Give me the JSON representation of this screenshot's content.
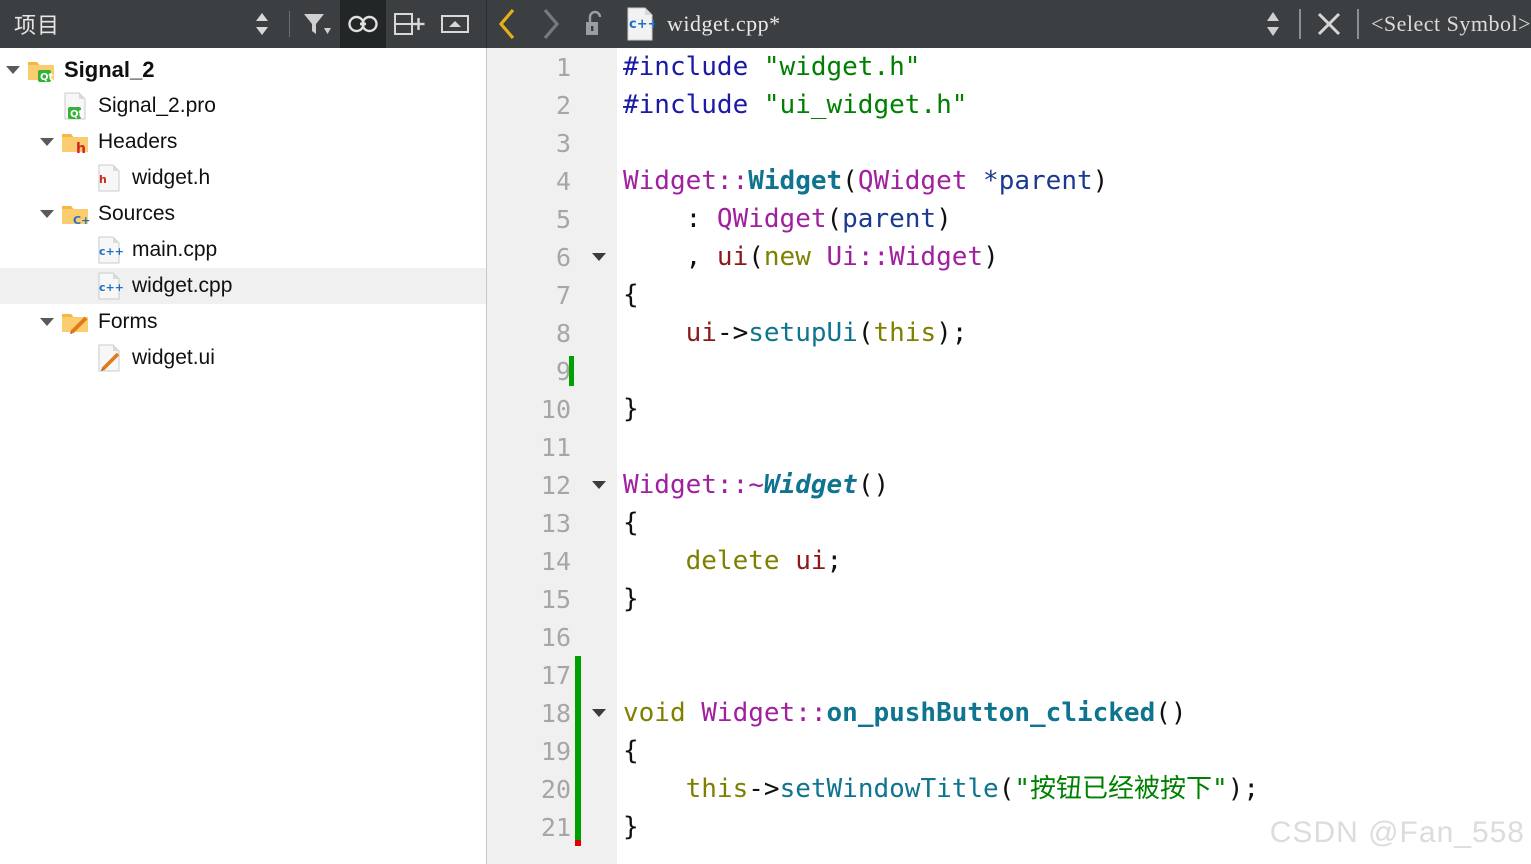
{
  "toolbar": {
    "panel_title": "项目",
    "left_icons": [
      {
        "name": "sort-updown-icon",
        "label": "sort"
      },
      {
        "name": "filter-icon",
        "label": "filter"
      },
      {
        "name": "link-sync-icon",
        "label": "synchronize-with-editor",
        "active": true
      },
      {
        "name": "split-add-icon",
        "label": "add-split"
      },
      {
        "name": "collapse-panel-icon",
        "label": "collapse"
      }
    ],
    "nav_back": "‹",
    "nav_forward": "›",
    "lock_icon": "unlocked-padlock-icon",
    "file_icon": "cpp-file-icon",
    "file_name": "widget.cpp*",
    "updown_icon": "updown-arrows-icon",
    "close_icon": "close-x-icon",
    "symbol_selector": "<Select Symbol>"
  },
  "tree": {
    "items": [
      {
        "label": "Signal_2",
        "indent": 0,
        "twist": "down",
        "icon": "qt-folder-icon",
        "bold": true,
        "selected": false
      },
      {
        "label": "Signal_2.pro",
        "indent": 1,
        "twist": "none",
        "icon": "qt-pro-file-icon",
        "bold": false,
        "selected": false
      },
      {
        "label": "Headers",
        "indent": 1,
        "twist": "down",
        "icon": "h-folder-icon",
        "bold": false,
        "selected": false
      },
      {
        "label": "widget.h",
        "indent": 2,
        "twist": "none",
        "icon": "h-file-icon",
        "bold": false,
        "selected": false
      },
      {
        "label": "Sources",
        "indent": 1,
        "twist": "down",
        "icon": "cpp-folder-icon",
        "bold": false,
        "selected": false
      },
      {
        "label": "main.cpp",
        "indent": 2,
        "twist": "none",
        "icon": "cpp-file-icon",
        "bold": false,
        "selected": false
      },
      {
        "label": "widget.cpp",
        "indent": 2,
        "twist": "none",
        "icon": "cpp-file-icon",
        "bold": false,
        "selected": true
      },
      {
        "label": "Forms",
        "indent": 1,
        "twist": "down",
        "icon": "forms-folder-icon",
        "bold": false,
        "selected": false
      },
      {
        "label": "widget.ui",
        "indent": 2,
        "twist": "none",
        "icon": "ui-file-icon",
        "bold": false,
        "selected": false
      }
    ]
  },
  "editor": {
    "file": "widget.cpp",
    "cursor_line": 9,
    "change_bar_color": "#00a000",
    "change_bar_end_color": "#e00000",
    "lines": [
      {
        "n": "1",
        "fold": false,
        "chg": "none",
        "tokens": [
          {
            "t": "#include ",
            "c": "t-pre"
          },
          {
            "t": "\"widget.h\"",
            "c": "t-str"
          }
        ]
      },
      {
        "n": "2",
        "fold": false,
        "chg": "none",
        "tokens": [
          {
            "t": "#include ",
            "c": "t-pre"
          },
          {
            "t": "\"ui_widget.h\"",
            "c": "t-str"
          }
        ]
      },
      {
        "n": "3",
        "fold": false,
        "chg": "none",
        "tokens": []
      },
      {
        "n": "4",
        "fold": false,
        "chg": "none",
        "tokens": [
          {
            "t": "Widget::",
            "c": "t-type"
          },
          {
            "t": "Widget",
            "c": "t-fnb"
          },
          {
            "t": "(",
            "c": "t-punc"
          },
          {
            "t": "QWidget ",
            "c": "t-type"
          },
          {
            "t": "*parent",
            "c": "t-param"
          },
          {
            "t": ")",
            "c": "t-punc"
          }
        ]
      },
      {
        "n": "5",
        "fold": false,
        "chg": "none",
        "tokens": [
          {
            "t": "    : ",
            "c": "t-punc"
          },
          {
            "t": "QWidget",
            "c": "t-type"
          },
          {
            "t": "(",
            "c": "t-punc"
          },
          {
            "t": "parent",
            "c": "t-param"
          },
          {
            "t": ")",
            "c": "t-punc"
          }
        ]
      },
      {
        "n": "6",
        "fold": true,
        "chg": "none",
        "tokens": [
          {
            "t": "    , ",
            "c": "t-punc"
          },
          {
            "t": "ui",
            "c": "t-var"
          },
          {
            "t": "(",
            "c": "t-punc"
          },
          {
            "t": "new ",
            "c": "t-kw"
          },
          {
            "t": "Ui::Widget",
            "c": "t-type"
          },
          {
            "t": ")",
            "c": "t-punc"
          }
        ]
      },
      {
        "n": "7",
        "fold": false,
        "chg": "none",
        "tokens": [
          {
            "t": "{",
            "c": "t-punc"
          }
        ]
      },
      {
        "n": "8",
        "fold": false,
        "chg": "none",
        "tokens": [
          {
            "t": "    ",
            "c": "t-punc"
          },
          {
            "t": "ui",
            "c": "t-var"
          },
          {
            "t": "->",
            "c": "t-op"
          },
          {
            "t": "setupUi",
            "c": "t-fn"
          },
          {
            "t": "(",
            "c": "t-punc"
          },
          {
            "t": "this",
            "c": "t-kw"
          },
          {
            "t": ");",
            "c": "t-punc"
          }
        ]
      },
      {
        "n": "9",
        "fold": false,
        "chg": "none",
        "tokens": []
      },
      {
        "n": "10",
        "fold": false,
        "chg": "none",
        "tokens": [
          {
            "t": "}",
            "c": "t-punc"
          }
        ]
      },
      {
        "n": "11",
        "fold": false,
        "chg": "none",
        "tokens": []
      },
      {
        "n": "12",
        "fold": true,
        "chg": "none",
        "tokens": [
          {
            "t": "Widget::~",
            "c": "t-type"
          },
          {
            "t": "Widget",
            "c": "t-fnbi"
          },
          {
            "t": "()",
            "c": "t-punc"
          }
        ]
      },
      {
        "n": "13",
        "fold": false,
        "chg": "none",
        "tokens": [
          {
            "t": "{",
            "c": "t-punc"
          }
        ]
      },
      {
        "n": "14",
        "fold": false,
        "chg": "none",
        "tokens": [
          {
            "t": "    ",
            "c": "t-punc"
          },
          {
            "t": "delete ",
            "c": "t-kw"
          },
          {
            "t": "ui",
            "c": "t-var"
          },
          {
            "t": ";",
            "c": "t-punc"
          }
        ]
      },
      {
        "n": "15",
        "fold": false,
        "chg": "none",
        "tokens": [
          {
            "t": "}",
            "c": "t-punc"
          }
        ]
      },
      {
        "n": "16",
        "fold": false,
        "chg": "none",
        "tokens": []
      },
      {
        "n": "17",
        "fold": false,
        "chg": "green",
        "tokens": []
      },
      {
        "n": "18",
        "fold": true,
        "chg": "green",
        "tokens": [
          {
            "t": "void ",
            "c": "t-kw"
          },
          {
            "t": "Widget::",
            "c": "t-type"
          },
          {
            "t": "on_pushButton_clicked",
            "c": "t-fnb"
          },
          {
            "t": "()",
            "c": "t-punc"
          }
        ]
      },
      {
        "n": "19",
        "fold": false,
        "chg": "green",
        "tokens": [
          {
            "t": "{",
            "c": "t-punc"
          }
        ]
      },
      {
        "n": "20",
        "fold": false,
        "chg": "green",
        "tokens": [
          {
            "t": "    ",
            "c": "t-punc"
          },
          {
            "t": "this",
            "c": "t-kw"
          },
          {
            "t": "->",
            "c": "t-op"
          },
          {
            "t": "setWindowTitle",
            "c": "t-fn"
          },
          {
            "t": "(",
            "c": "t-punc"
          },
          {
            "t": "\"按钮已经被按下\"",
            "c": "t-str"
          },
          {
            "t": ");",
            "c": "t-punc"
          }
        ]
      },
      {
        "n": "21",
        "fold": false,
        "chg": "green-red",
        "tokens": [
          {
            "t": "}",
            "c": "t-punc"
          }
        ]
      }
    ]
  },
  "watermark": "CSDN @Fan_558",
  "colors": {
    "toolbar_bg": "#3b3f41",
    "toolbar_active_bg": "#232627",
    "gutter_bg": "#f0f0f0",
    "selection_bg": "#f0f0f0",
    "back_arrow": "#e8b014"
  }
}
